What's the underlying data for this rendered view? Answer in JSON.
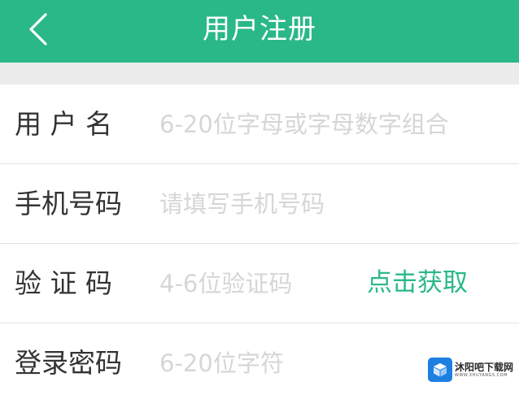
{
  "header": {
    "title": "用户注册",
    "background": "#2ab889"
  },
  "form": {
    "rows": [
      {
        "label": "用 户 名",
        "placeholder": "6-20位字母或字母数字组合"
      },
      {
        "label": "手机号码",
        "placeholder": "请填写手机号码"
      },
      {
        "label": "验 证 码",
        "placeholder": "4-6位验证码",
        "action": "点击获取"
      },
      {
        "label": "登录密码",
        "placeholder": "6-20位字符"
      }
    ]
  },
  "watermark": {
    "name": "沐阳吧下载网",
    "url": "WWW.XHUYANGS.COM"
  },
  "icons": {
    "back": "chevron-left-icon",
    "watermark_logo": "box-logo-icon"
  },
  "colors": {
    "accent": "#2ab889",
    "placeholder": "#d6d6d6",
    "label": "#333333"
  }
}
